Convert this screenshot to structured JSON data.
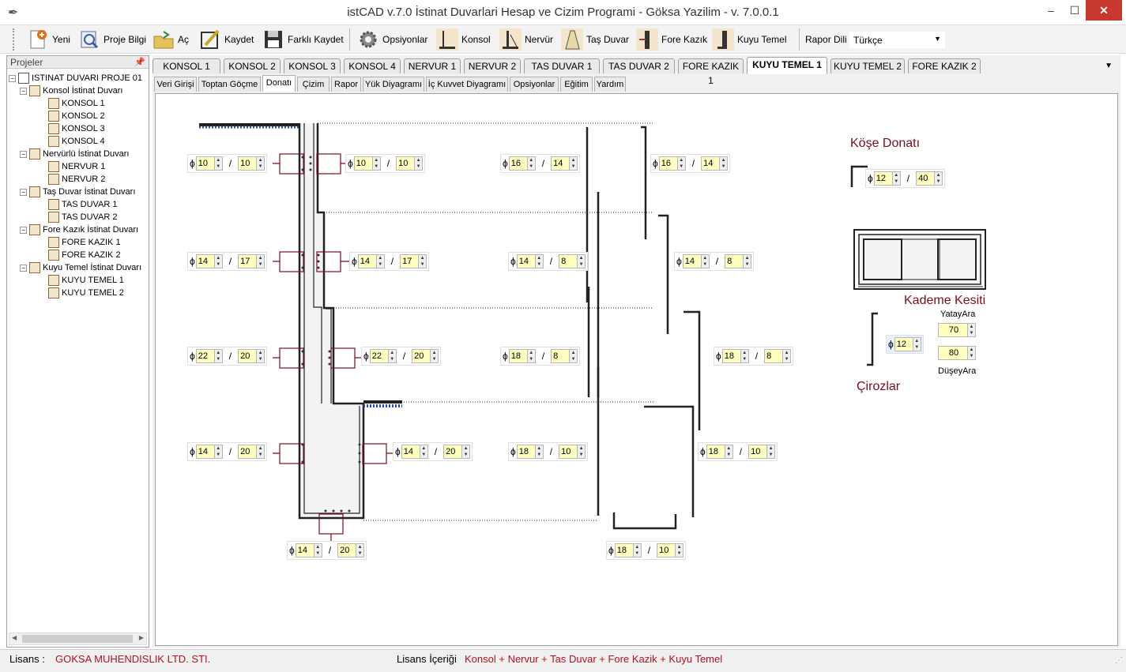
{
  "window": {
    "title": "istCAD v.7.0 İstinat Duvarlari Hesap ve Cizim Programi - Göksa Yazilim - v. 7.0.0.1",
    "min": "–",
    "max": "☐",
    "close": "✕"
  },
  "toolbar": {
    "yeni": "Yeni",
    "proje_bilgi": "Proje Bilgi",
    "ac": "Aç",
    "kaydet": "Kaydet",
    "farkli_kaydet": "Farklı Kaydet",
    "opsiyonlar": "Opsiyonlar",
    "konsol": "Konsol",
    "nervur": "Nervür",
    "tas_duvar": "Taş Duvar",
    "fore_kazik": "Fore Kazık",
    "kuyu_temel": "Kuyu Temel",
    "rapor_dili": "Rapor Dili",
    "lang_value": "Türkçe"
  },
  "projects": {
    "header": "Projeler",
    "pin": "📌",
    "root": "ISTINAT DUVARI PROJE 01",
    "groups": [
      {
        "name": "Konsol İstinat Duvarı",
        "items": [
          "KONSOL 1",
          "KONSOL 2",
          "KONSOL 3",
          "KONSOL 4"
        ]
      },
      {
        "name": "Nervürlü İstinat Duvarı",
        "items": [
          "NERVUR 1",
          "NERVUR 2"
        ]
      },
      {
        "name": "Taş Duvar İstinat Duvarı",
        "items": [
          "TAS DUVAR 1",
          "TAS DUVAR 2"
        ]
      },
      {
        "name": "Fore Kazık İstinat Duvarı",
        "items": [
          "FORE KAZIK 1",
          "FORE KAZIK 2"
        ]
      },
      {
        "name": "Kuyu Temel İstinat Duvarı",
        "items": [
          "KUYU TEMEL 1",
          "KUYU TEMEL 2"
        ]
      }
    ]
  },
  "tabs_top": [
    "KONSOL 1",
    "KONSOL 2",
    "KONSOL 3",
    "KONSOL 4",
    "NERVUR 1",
    "NERVUR 2",
    "TAS DUVAR 1",
    "TAS DUVAR 2",
    "FORE KAZIK 1",
    "KUYU TEMEL 1",
    "KUYU TEMEL 2",
    "FORE KAZIK 2"
  ],
  "tabs_top_active": 9,
  "tabs_sub": [
    "Veri Girişi",
    "Toptan Göçme",
    "Donatı",
    "Çizim",
    "Rapor",
    "Yük Diyagramı",
    "İç Kuvvet Diyagramı",
    "Opsiyonlar",
    "Eğitim",
    "Yardım"
  ],
  "tabs_sub_active": 2,
  "rebar": {
    "phi": "ϕ",
    "slash": "/",
    "fields": [
      {
        "d": "10",
        "s": "10"
      },
      {
        "d": "10",
        "s": "10"
      },
      {
        "d": "16",
        "s": "14"
      },
      {
        "d": "16",
        "s": "14"
      },
      {
        "d": "14",
        "s": "17"
      },
      {
        "d": "14",
        "s": "17"
      },
      {
        "d": "14",
        "s": "8"
      },
      {
        "d": "14",
        "s": "8"
      },
      {
        "d": "22",
        "s": "20"
      },
      {
        "d": "22",
        "s": "20"
      },
      {
        "d": "18",
        "s": "8"
      },
      {
        "d": "18",
        "s": "8"
      },
      {
        "d": "14",
        "s": "20"
      },
      {
        "d": "14",
        "s": "20"
      },
      {
        "d": "18",
        "s": "10"
      },
      {
        "d": "18",
        "s": "10"
      },
      {
        "d": "14",
        "s": "20"
      },
      {
        "d": "18",
        "s": "10"
      }
    ]
  },
  "corner": {
    "title": "Köşe Donatı",
    "d": "12",
    "s": "40"
  },
  "section": {
    "title": "Kademe Kesiti"
  },
  "stirrups": {
    "title": "Çirozlar",
    "d": "12",
    "yatay_label": "YatayAra",
    "yatay": "70",
    "dusey_label": "DüşeyAra",
    "dusey": "80"
  },
  "status": {
    "lisans_label": "Lisans :",
    "lisans_value": "GOKSA MUHENDISLIK LTD. STI.",
    "icerik_label": "Lisans İçeriği",
    "icerik_value": "Konsol + Nervur + Tas Duvar + Fore Kazik + Kuyu Temel"
  },
  "colors": {
    "accent_red": "#7a0e1e",
    "field_bg": "#ffffc0"
  }
}
